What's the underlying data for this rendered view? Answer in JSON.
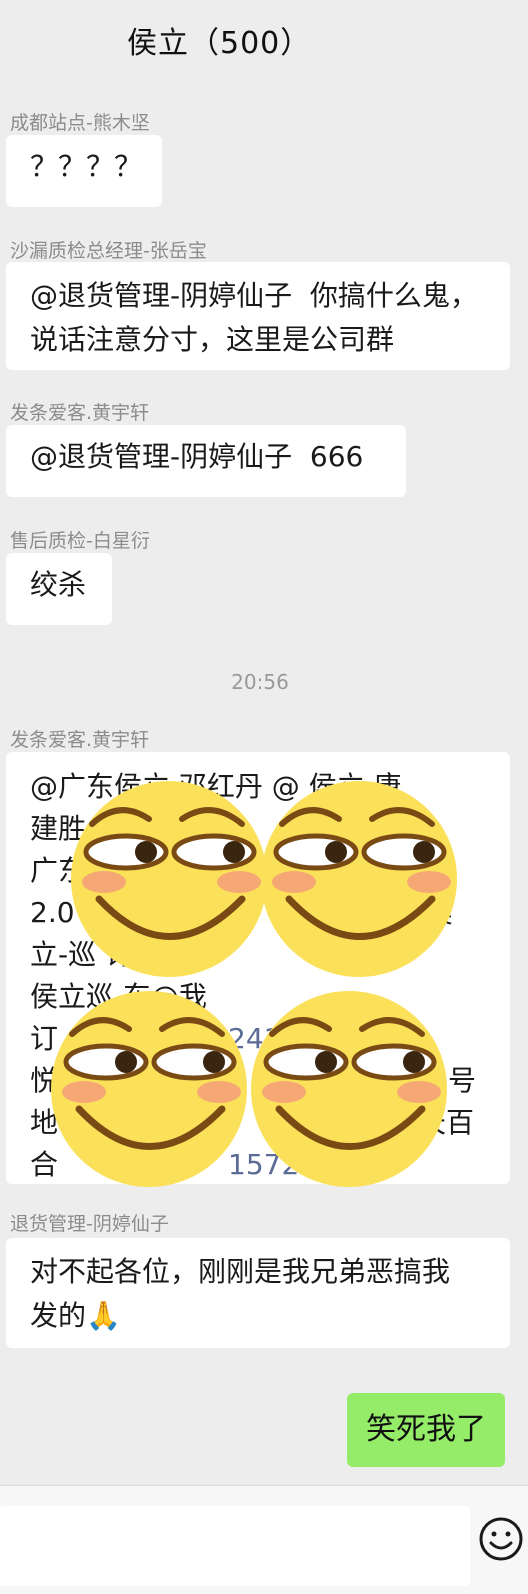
{
  "header": {
    "title": "侯立（500）"
  },
  "messages": [
    {
      "sender": "成都站点-熊木坚",
      "text": "？？？？"
    },
    {
      "sender": "沙漏质检总经理-张岳宝",
      "text": "@退货管理-阴婷仙子  你搞什么鬼，\n说话注意分寸，这里是公司群"
    },
    {
      "sender": "发条爱客.黄宇轩",
      "text": "@退货管理-阴婷仙子  666"
    },
    {
      "sender": "售后质检-白星衍",
      "text": "绞杀"
    },
    {
      "sender": "发条爱客.黄宇轩",
      "lines": [
        "@广东侯立 邓红丹 @      侯立  唐",
        "建胜",
        "广东",
        "2.0",
        "立-巡                       许    ",
        "侯立巡        东@我",
        "订",
        "悦",
        "地",
        "合"
      ],
      "fragments": {
        "r1_tail": "                                 百@",
        "r3_tail": "~",
        "r4_tail": "-侯",
        "r5_tail": "思琪",
        "r6_mid": "2417",
        "r7_tail": "号",
        "r8_tail": "天百",
        "r9_mid": "1572"
      }
    },
    {
      "sender": "退货管理-阴婷仙子",
      "text": "对不起各位，刚刚是我兄弟恶搞我\n发的🙏"
    }
  ],
  "timestamp": "20:56",
  "self_message": {
    "text": "笑死我了"
  },
  "icons": {
    "emoji_button": "smiley-icon",
    "stickers": "smirk-face-sticker"
  },
  "colors": {
    "self_bubble": "#95ec69",
    "other_bubble": "#ffffff",
    "background": "#ededed"
  }
}
